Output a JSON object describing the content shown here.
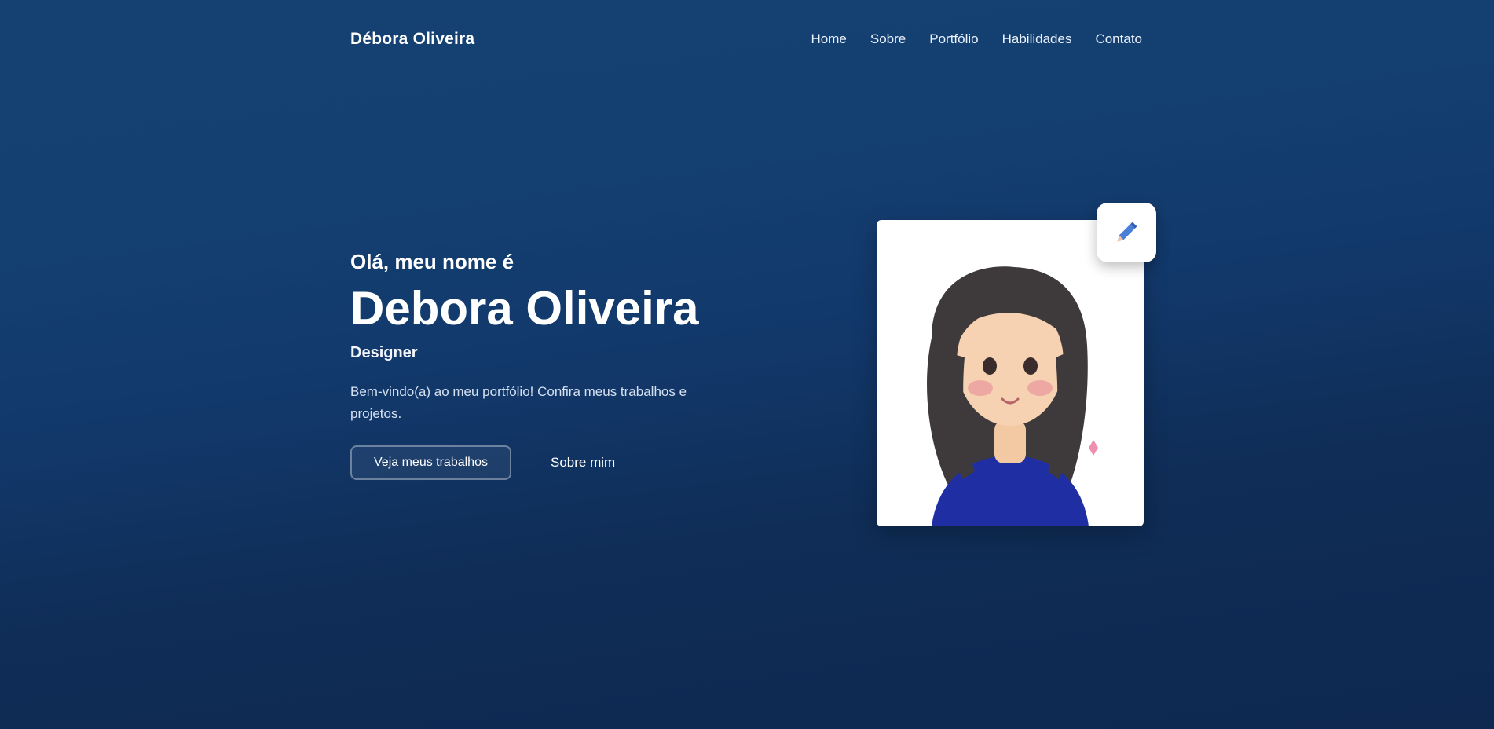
{
  "header": {
    "logo": "Débora Oliveira",
    "nav": [
      "Home",
      "Sobre",
      "Portfólio",
      "Habilidades",
      "Contato"
    ]
  },
  "hero": {
    "greeting": "Olá, meu nome é",
    "name": "Debora Oliveira",
    "role": "Designer",
    "intro": "Bem-vindo(a) ao meu portfólio! Confira meus trabalhos e projetos.",
    "primary_button": "Veja meus trabalhos",
    "secondary_link": "Sobre mim"
  },
  "portrait": {
    "edit_icon": "pencil-icon"
  },
  "colors": {
    "background_top": "#154172",
    "background_bottom": "#0e2850",
    "card": "#ffffff",
    "avatar_shirt": "#1f2fa3",
    "avatar_hair": "#3e3a3b"
  }
}
